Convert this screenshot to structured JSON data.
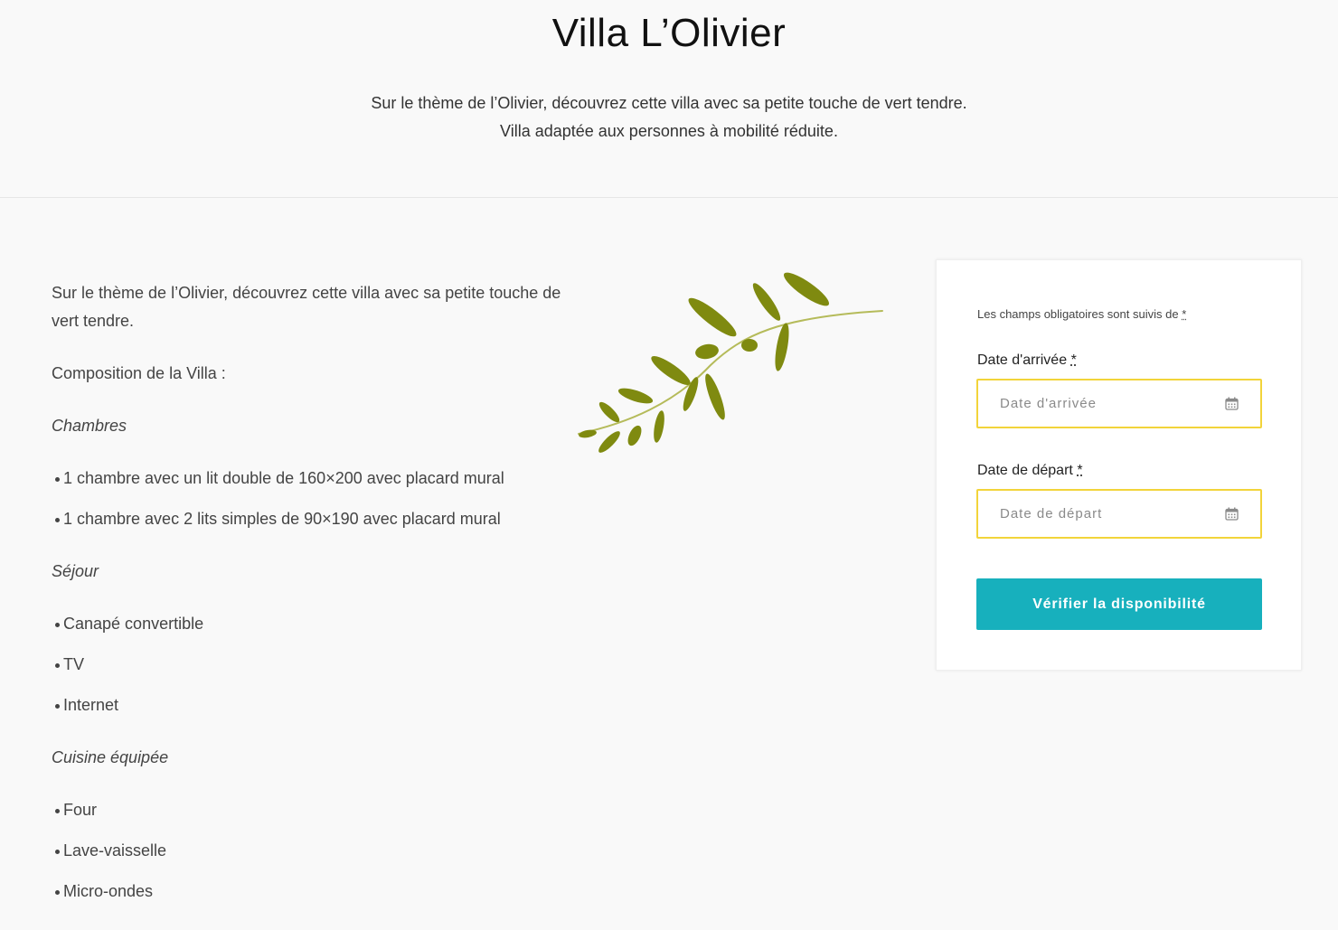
{
  "hero": {
    "title": "Villa L’Olivier",
    "intro_line1": "Sur le thème de l’Olivier, découvrez cette villa avec sa petite touche de vert tendre.",
    "intro_line2": "Villa adaptée aux personnes à mobilité réduite."
  },
  "content": {
    "description": "Sur le thème de l’Olivier, découvrez cette villa avec sa petite touche de vert tendre.",
    "composition": "Composition de la Villa :",
    "sections": [
      {
        "title": "Chambres",
        "items": [
          "1 chambre avec un lit double de 160×200 avec placard mural",
          "1 chambre avec 2 lits simples de 90×190 avec placard mural"
        ]
      },
      {
        "title": "Séjour",
        "items": [
          "Canapé convertible",
          "TV",
          "Internet"
        ]
      },
      {
        "title": "Cuisine équipée",
        "items": [
          "Four",
          "Lave-vaisselle",
          "Micro-ondes"
        ]
      }
    ]
  },
  "booking": {
    "required_note": "Les champs obligatoires sont suivis de",
    "required_marker": "*",
    "arrival_label": "Date d'arrivée",
    "arrival_placeholder": "Date d'arrivée",
    "arrival_value": "",
    "departure_label": "Date de départ",
    "departure_placeholder": "Date de départ",
    "departure_value": "",
    "calendar_icon": "calendar-icon",
    "submit_label": "Vérifier la disponibilité"
  },
  "decoration": {
    "icon": "olive-branch-icon"
  },
  "colors": {
    "page_background": "#f9f9f9",
    "accent_button": "#17b0bd",
    "field_border": "#f2d43a",
    "olive_leaf": "#7f8a10",
    "olive_stem": "#b5bb5a"
  }
}
